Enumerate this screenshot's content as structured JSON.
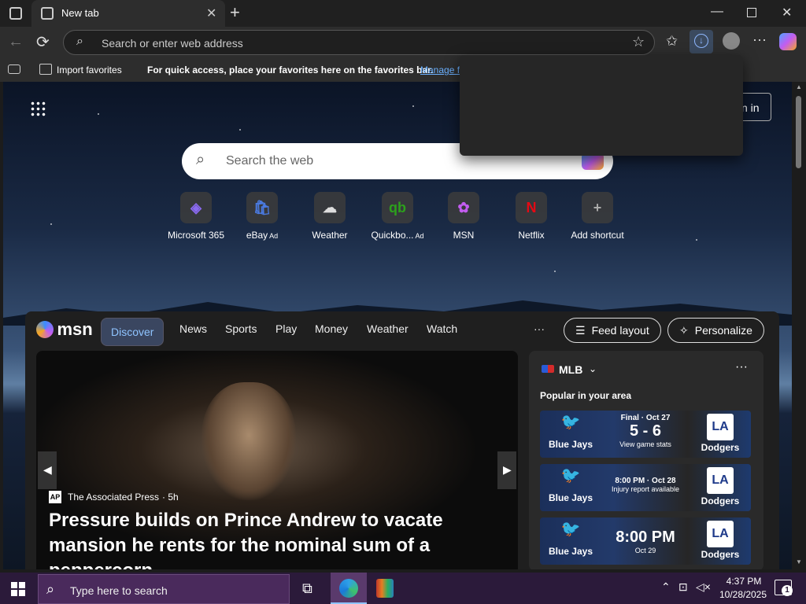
{
  "browser": {
    "tab_title": "New tab",
    "address_placeholder": "Search or enter web address",
    "favorites": {
      "import_label": "Import favorites",
      "hint": "For quick access, place your favorites here on the favorites bar.",
      "manage_link": "Manage f"
    },
    "signin_partial": "n in"
  },
  "newtab": {
    "search_placeholder": "Search the web",
    "shortcuts": [
      {
        "label": "Microsoft 365",
        "ad": "",
        "icon": "microsoft-365-icon"
      },
      {
        "label": "eBay",
        "ad": "Ad",
        "icon": "ebay-icon"
      },
      {
        "label": "Weather",
        "ad": "",
        "icon": "weather-icon"
      },
      {
        "label": "Quickbo...",
        "ad": "Ad",
        "icon": "quickbooks-icon"
      },
      {
        "label": "MSN",
        "ad": "",
        "icon": "msn-icon"
      },
      {
        "label": "Netflix",
        "ad": "",
        "icon": "netflix-icon"
      },
      {
        "label": "Add shortcut",
        "ad": "",
        "icon": "plus-icon"
      }
    ]
  },
  "msn": {
    "logo_text": "msn",
    "nav": [
      "Discover",
      "News",
      "Sports",
      "Play",
      "Money",
      "Weather",
      "Watch"
    ],
    "more": "···",
    "feed_layout": "Feed layout",
    "personalize": "Personalize",
    "hero": {
      "source_badge": "AP",
      "source": "The Associated Press",
      "age": "· 5h",
      "headline": "Pressure builds on Prince Andrew to vacate mansion he rents for the nominal sum of a peppercorn"
    },
    "mlb": {
      "title": "MLB",
      "subtitle": "Popular in your area",
      "games": [
        {
          "status": "Final · Oct 27",
          "main": "5 - 6",
          "sub": "View game stats",
          "home": "Blue Jays",
          "away": "Dodgers"
        },
        {
          "status": "8:00 PM · Oct 28",
          "main": "",
          "sub": "Injury report available",
          "home": "Blue Jays",
          "away": "Dodgers"
        },
        {
          "status": "",
          "main": "8:00 PM",
          "sub": "Oct 29",
          "home": "Blue Jays",
          "away": "Dodgers"
        }
      ]
    }
  },
  "taskbar": {
    "search_placeholder": "Type here to search",
    "time": "4:37 PM",
    "date": "10/28/2025",
    "notification_count": "1"
  },
  "colors": {
    "accent": "#4f8fe8",
    "taskbar": "#2b1a3a",
    "discover_pill": "#3a4660"
  }
}
